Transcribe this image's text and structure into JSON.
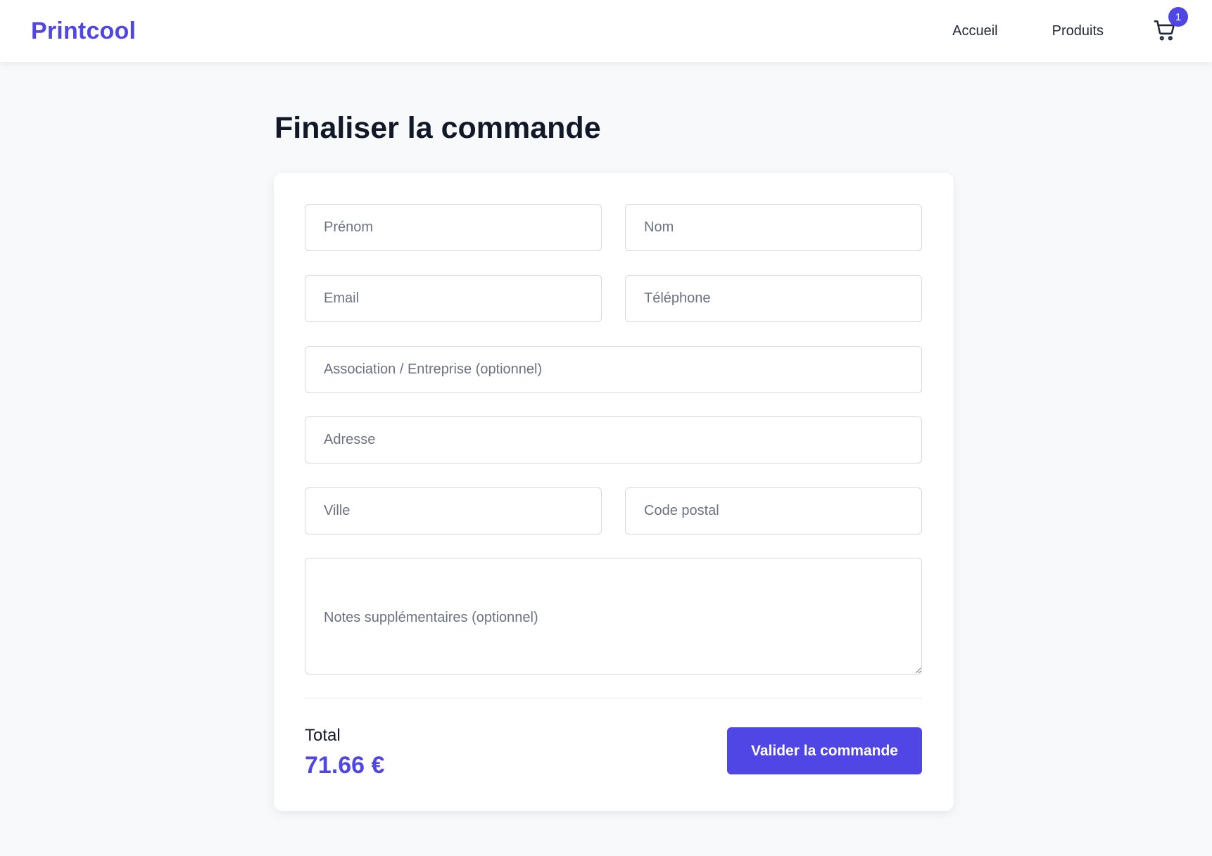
{
  "header": {
    "brand": "Printcool",
    "nav": [
      "Accueil",
      "Produits"
    ],
    "cart_icon": "shopping-cart-icon",
    "cart_count": "1"
  },
  "page": {
    "title": "Finaliser la commande"
  },
  "form": {
    "first_name": {
      "placeholder": "Prénom",
      "value": ""
    },
    "last_name": {
      "placeholder": "Nom",
      "value": ""
    },
    "email": {
      "placeholder": "Email",
      "value": ""
    },
    "phone": {
      "placeholder": "Téléphone",
      "value": ""
    },
    "organization": {
      "placeholder": "Association / Entreprise (optionnel)",
      "value": ""
    },
    "address": {
      "placeholder": "Adresse",
      "value": ""
    },
    "city": {
      "placeholder": "Ville",
      "value": ""
    },
    "postal_code": {
      "placeholder": "Code postal",
      "value": ""
    },
    "notes": {
      "placeholder": "Notes supplémentaires (optionnel)",
      "value": ""
    }
  },
  "summary": {
    "total_label": "Total",
    "total_value": "71.66 €",
    "submit_label": "Valider la commande"
  },
  "colors": {
    "accent": "#4f46e5",
    "background": "#f8f9fb",
    "card": "#ffffff",
    "text": "#111827",
    "placeholder": "#6b7280",
    "border": "#d6d9de"
  }
}
